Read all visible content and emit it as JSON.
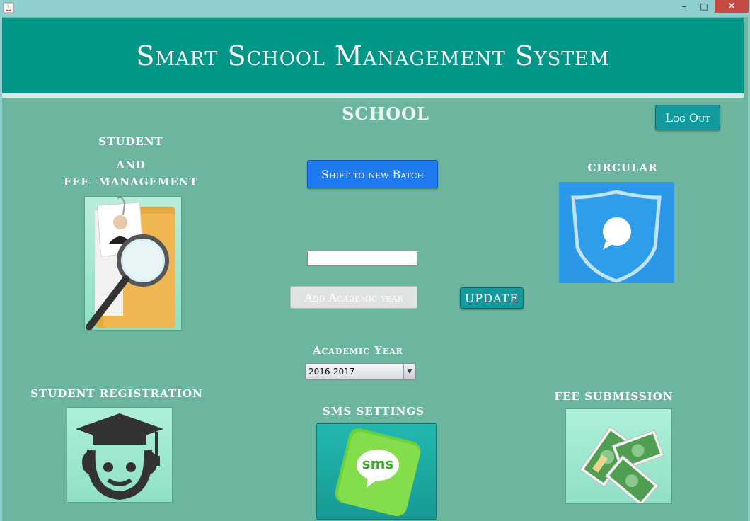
{
  "window": {
    "minimize_glyph": "–",
    "maximize_glyph": "□",
    "close_glyph": "✕"
  },
  "header": {
    "title": "Smart School Management System"
  },
  "school_label": "SCHOOL",
  "logout_label": "Log Out",
  "student_fee": {
    "line1": "STUDENT",
    "line2": "AND",
    "line3": "FEE  MANAGEMENT"
  },
  "circular_label": "CIRCULAR",
  "shift_batch_label": "Shift to new Batch",
  "academic_year_input": {
    "value": ""
  },
  "add_academic_year_label": "Add Academic year",
  "update_label": "UPDATE",
  "academic_year": {
    "label": "Academic Year",
    "selected": "2016-2017"
  },
  "student_registration_label": "STUDENT REGISTRATION",
  "sms_settings_label": "SMS SETTINGS",
  "sms_icon_text": "sms",
  "fee_submission_label": "FEE SUBMISSION",
  "colors": {
    "header_bg": "#009688",
    "body_bg": "#6cb59e",
    "accent_button": "#129a9e",
    "primary_button": "#1e7bf0"
  },
  "icons": [
    "java-icon",
    "folder-magnifier-icon",
    "shield-chat-icon",
    "graduate-icon",
    "sms-bubble-icon",
    "money-stack-icon"
  ]
}
